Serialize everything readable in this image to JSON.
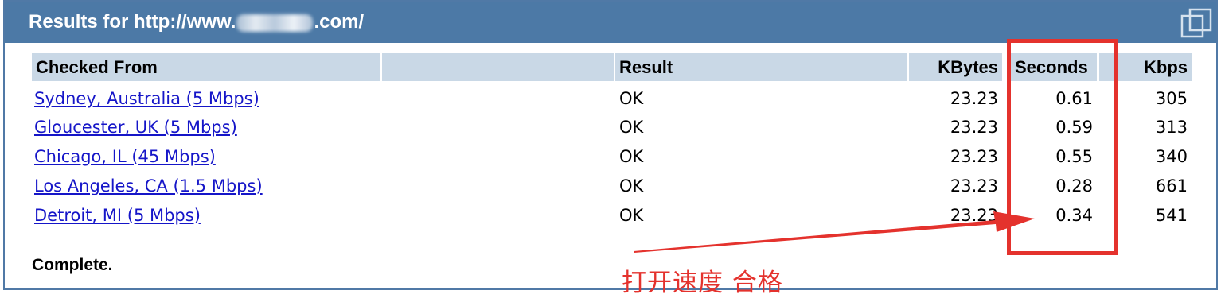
{
  "header": {
    "title_prefix": "Results for http://www.",
    "title_suffix": ".com/"
  },
  "table": {
    "columns": {
      "checked_from": "Checked From",
      "result": "Result",
      "kbytes": "KBytes",
      "seconds": "Seconds",
      "kbps": "Kbps"
    },
    "rows": [
      {
        "location": "Sydney, Australia (5 Mbps)",
        "result": "OK",
        "kbytes": "23.23",
        "seconds": "0.61",
        "kbps": "305"
      },
      {
        "location": "Gloucester, UK (5 Mbps)",
        "result": "OK",
        "kbytes": "23.23",
        "seconds": "0.59",
        "kbps": "313"
      },
      {
        "location": "Chicago, IL (45 Mbps)",
        "result": "OK",
        "kbytes": "23.23",
        "seconds": "0.55",
        "kbps": "340"
      },
      {
        "location": "Los Angeles, CA (1.5 Mbps)",
        "result": "OK",
        "kbytes": "23.23",
        "seconds": "0.28",
        "kbps": "661"
      },
      {
        "location": "Detroit, MI (5 Mbps)",
        "result": "OK",
        "kbytes": "23.23",
        "seconds": "0.34",
        "kbps": "541"
      }
    ]
  },
  "status": "Complete.",
  "annotation": {
    "note": "打开速度  合格",
    "color": "#e4322d"
  },
  "colors": {
    "header_bg": "#4c79a6",
    "column_header_bg": "#c9d8e6",
    "link": "#1515c8"
  },
  "icons": {
    "window": "window-restore-icon"
  }
}
